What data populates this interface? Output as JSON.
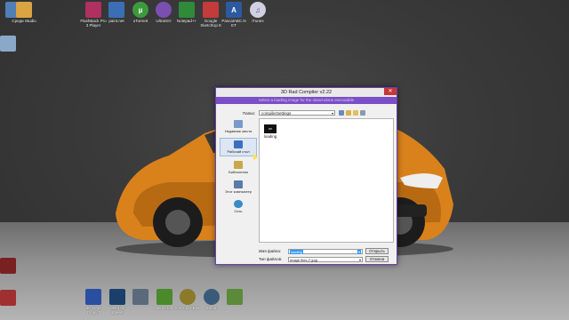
{
  "desktop": {
    "top_icons": [
      {
        "label": "",
        "icon": "folder-icon",
        "color": "#4f7fb6"
      },
      {
        "label": "Среди Studio",
        "icon": "folder-icon",
        "color": "#d9a441"
      },
      {
        "label": "FlashBack Pro 3 Player",
        "icon": "app-icon",
        "color": "#b03060"
      },
      {
        "label": "paint.net",
        "icon": "paint-icon",
        "color": "#3a6fb5"
      },
      {
        "label": "uTorrent",
        "icon": "torrent-icon",
        "color": "#3c9a3c"
      },
      {
        "label": "UltraISO",
        "icon": "disc-icon",
        "color": "#7a4fb0"
      },
      {
        "label": "Notepad++",
        "icon": "notepad-icon",
        "color": "#2f8a3a"
      },
      {
        "label": "Google SketchUp 8",
        "icon": "sketchup-icon",
        "color": "#c43b3b"
      },
      {
        "label": "PascalABC.NET",
        "icon": "abc-icon",
        "color": "#2c5aa0"
      },
      {
        "label": "iTunes",
        "icon": "itunes-icon",
        "color": "#d0d0e0"
      }
    ],
    "left_icons": [
      {
        "label": "",
        "icon": "recycle-bin-icon",
        "color": "#8aa8c8"
      },
      {
        "label": "",
        "icon": "app-icon",
        "color": "#7a2020"
      },
      {
        "label": "",
        "icon": "app-icon",
        "color": "#a03030"
      }
    ],
    "bottom_icons": [
      {
        "label": "3D RAD Project",
        "icon": "3drad-icon",
        "color": "#2a4fa0"
      },
      {
        "label": "Need for Speed",
        "icon": "nfs-icon",
        "color": "#1a3f6a"
      },
      {
        "label": "",
        "icon": "nfs-icon",
        "color": "#5a6a7a"
      },
      {
        "label": "Minecraft",
        "icon": "minecraft-icon",
        "color": "#4a8a2a"
      },
      {
        "label": "S.T.A.L.K.E.R.",
        "icon": "stalker-icon",
        "color": "#8a7a2a"
      },
      {
        "label": "Steam",
        "icon": "steam-icon",
        "color": "#3a5a7a"
      },
      {
        "label": "",
        "icon": "app-icon",
        "color": "#5a8a3a"
      }
    ]
  },
  "dialog": {
    "title": "3D Rad Compiler v2.22",
    "close_label": "✕",
    "banner": "Select a loading image for the stand-alone executable",
    "folder_label": "Папка:",
    "folder_value": "compilerSettings",
    "places": [
      {
        "label": "Недавние места",
        "icon": "recent-places-icon",
        "color": "#7a9ac8"
      },
      {
        "label": "Рабочий стол",
        "icon": "desktop-icon",
        "color": "#3a6fc0"
      },
      {
        "label": "Библиотеки",
        "icon": "libraries-icon",
        "color": "#c8a84a"
      },
      {
        "label": "Этот компьютер",
        "icon": "computer-icon",
        "color": "#5a7aa8"
      },
      {
        "label": "Сеть",
        "icon": "network-icon",
        "color": "#3a8ac8"
      }
    ],
    "file": {
      "name": "loading",
      "thumb_text": "ОР"
    },
    "filename_label": "Имя файла:",
    "filename_value": "loading",
    "filetype_label": "Тип файлов:",
    "filetype_value": "Image files (*.jpg)",
    "open_label": "Открыть",
    "cancel_label": "Отмена"
  },
  "colors": {
    "accent": "#7b4fc7",
    "car": "#d9821c"
  }
}
